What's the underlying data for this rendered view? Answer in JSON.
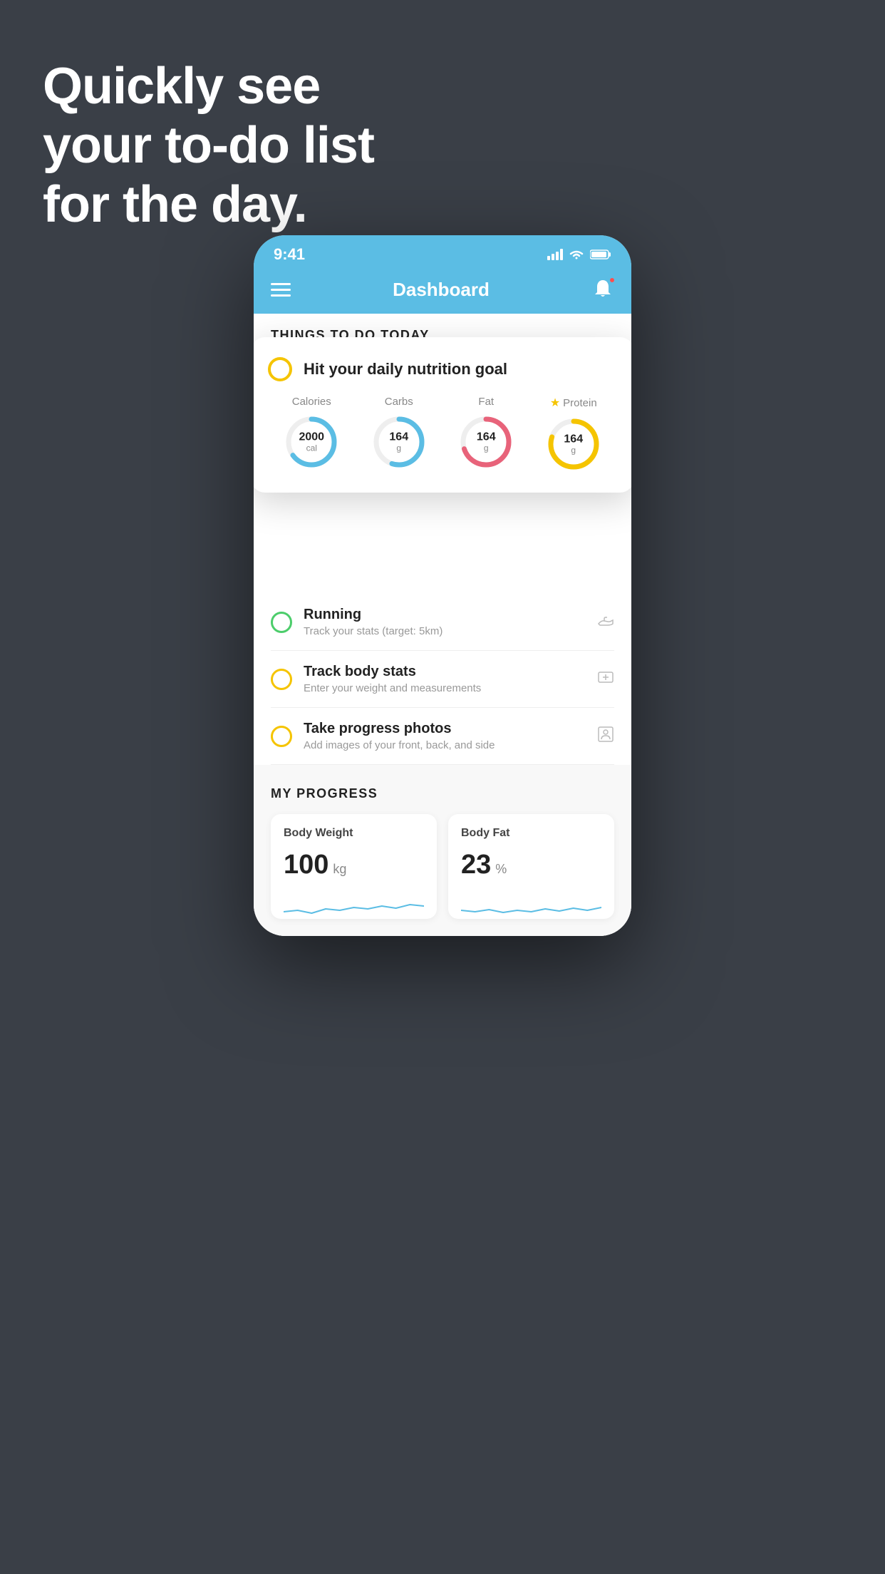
{
  "hero": {
    "line1": "Quickly see",
    "line2": "your to-do list",
    "line3": "for the day."
  },
  "status_bar": {
    "time": "9:41"
  },
  "header": {
    "title": "Dashboard"
  },
  "section_today": {
    "title": "THINGS TO DO TODAY"
  },
  "floating_card": {
    "title": "Hit your daily nutrition goal",
    "items": [
      {
        "label": "Calories",
        "value": "2000",
        "unit": "cal",
        "color": "#5bbde4",
        "star": false,
        "pct": 65
      },
      {
        "label": "Carbs",
        "value": "164",
        "unit": "g",
        "color": "#5bbde4",
        "star": false,
        "pct": 55
      },
      {
        "label": "Fat",
        "value": "164",
        "unit": "g",
        "color": "#e8637a",
        "star": false,
        "pct": 70
      },
      {
        "label": "Protein",
        "value": "164",
        "unit": "g",
        "color": "#f5c400",
        "star": true,
        "pct": 80
      }
    ]
  },
  "todo_items": [
    {
      "id": "running",
      "circle": "green",
      "main": "Running",
      "sub": "Track your stats (target: 5km)",
      "icon": "shoe"
    },
    {
      "id": "body-stats",
      "circle": "yellow",
      "main": "Track body stats",
      "sub": "Enter your weight and measurements",
      "icon": "scale"
    },
    {
      "id": "photos",
      "circle": "yellow",
      "main": "Take progress photos",
      "sub": "Add images of your front, back, and side",
      "icon": "person"
    }
  ],
  "progress_section": {
    "title": "MY PROGRESS",
    "cards": [
      {
        "title": "Body Weight",
        "value": "100",
        "unit": "kg"
      },
      {
        "title": "Body Fat",
        "value": "23",
        "unit": "%"
      }
    ]
  }
}
